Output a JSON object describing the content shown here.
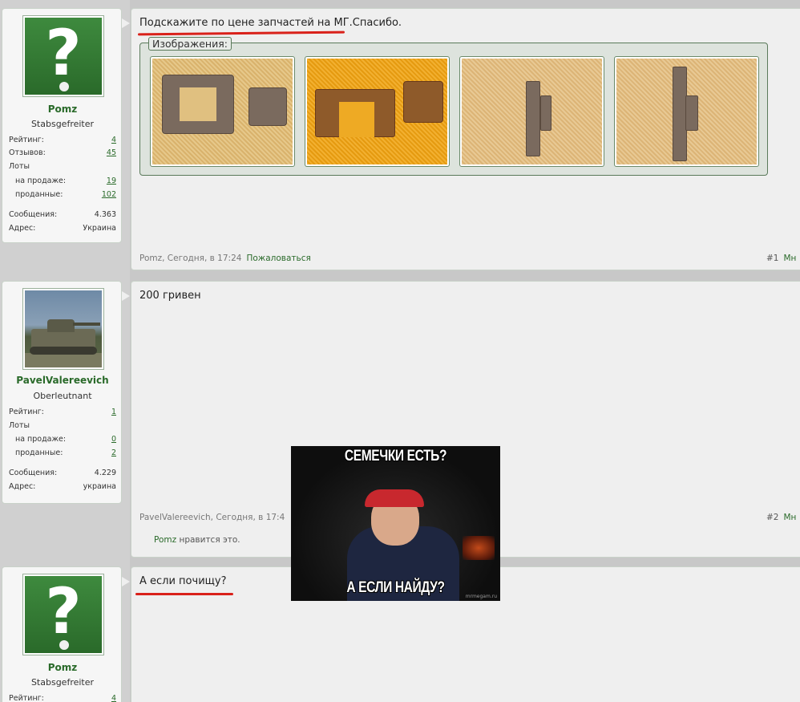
{
  "posts": [
    {
      "user": {
        "name": "Pomz",
        "rank": "Stabsgefreiter",
        "avatar": "question-mark-avatar",
        "stats": [
          {
            "label": "Рейтинг:",
            "value": "4",
            "link": true,
            "indent": false
          },
          {
            "label": "Отзывов:",
            "value": "45",
            "link": true,
            "indent": false
          },
          {
            "label": "Лоты",
            "value": "",
            "link": false,
            "indent": false
          },
          {
            "label": "на продаже:",
            "value": "19",
            "link": true,
            "indent": true
          },
          {
            "label": "проданные:",
            "value": "102",
            "link": true,
            "indent": true
          },
          {
            "label": "Сообщения:",
            "value": "4.363",
            "link": false,
            "indent": false
          },
          {
            "label": "Адрес:",
            "value": "Украина",
            "link": false,
            "indent": false
          }
        ]
      },
      "text": "Подскажите по цене запчастей на МГ.Спасибо.",
      "attachments_legend": "Изображения:",
      "footer": {
        "author": "Pomz",
        "time": ", Сегодня, в 17:24",
        "report": "Пожаловаться",
        "num": "#1",
        "more": "Мн"
      }
    },
    {
      "user": {
        "name": "PavelValereevich",
        "rank": "Oberleutnant",
        "avatar": "tank-avatar",
        "stats": [
          {
            "label": "Рейтинг:",
            "value": "1",
            "link": true,
            "indent": false
          },
          {
            "label": "Лоты",
            "value": "",
            "link": false,
            "indent": false
          },
          {
            "label": "на продаже:",
            "value": "0",
            "link": true,
            "indent": true
          },
          {
            "label": "проданные:",
            "value": "2",
            "link": true,
            "indent": true
          },
          {
            "label": "Сообщения:",
            "value": "4.229",
            "link": false,
            "indent": false
          },
          {
            "label": "Адрес:",
            "value": "украина",
            "link": false,
            "indent": false
          }
        ]
      },
      "text": "200 гривен",
      "footer": {
        "author": "PavelValereevich",
        "time": ", Сегодня, в 17:4",
        "num": "#2",
        "more": "Мн"
      },
      "likes": {
        "name": "Pomz",
        "text": " нравится это."
      }
    },
    {
      "user": {
        "name": "Pomz",
        "rank": "Stabsgefreiter",
        "avatar": "question-mark-avatar",
        "stats": [
          {
            "label": "Рейтинг:",
            "value": "4",
            "link": true,
            "indent": false
          }
        ]
      },
      "text": "А если почищу?"
    }
  ],
  "meme": {
    "top_text": "СЕМЕЧКИ ЕСТЬ?",
    "bottom_text": "А ЕСЛИ НАЙДУ?",
    "watermark": "mrmegam.ru"
  },
  "colors": {
    "accent_green": "#2a6a2a",
    "underline_red": "#d9211a"
  }
}
